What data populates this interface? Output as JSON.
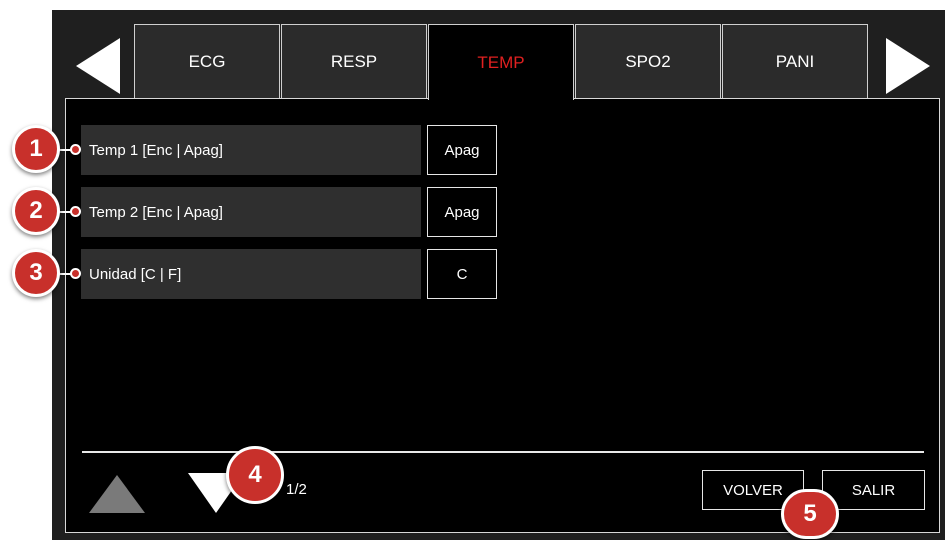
{
  "tabs": [
    {
      "label": "ECG",
      "active": false
    },
    {
      "label": "RESP",
      "active": false
    },
    {
      "label": "TEMP",
      "active": true
    },
    {
      "label": "SPO2",
      "active": false
    },
    {
      "label": "PANI",
      "active": false
    }
  ],
  "settings": [
    {
      "label": "Temp 1 [Enc | Apag]",
      "value": "Apag",
      "callout": "1"
    },
    {
      "label": "Temp 2 [Enc | Apag]",
      "value": "Apag",
      "callout": "2"
    },
    {
      "label": "Unidad [C | F]",
      "value": "C",
      "callout": "3"
    }
  ],
  "footer": {
    "page_indicator": "1/2",
    "volver_label": "VOLVER",
    "salir_label": "SALIR",
    "page_callout": "4",
    "buttons_callout": "5"
  },
  "colors": {
    "active_tab_text": "#e02020",
    "callout": "#c8302b"
  },
  "icons": {
    "prev_tab": "triangle-left-icon",
    "next_tab": "triangle-right-icon",
    "page_up": "triangle-up-icon",
    "page_down": "triangle-down-icon"
  }
}
